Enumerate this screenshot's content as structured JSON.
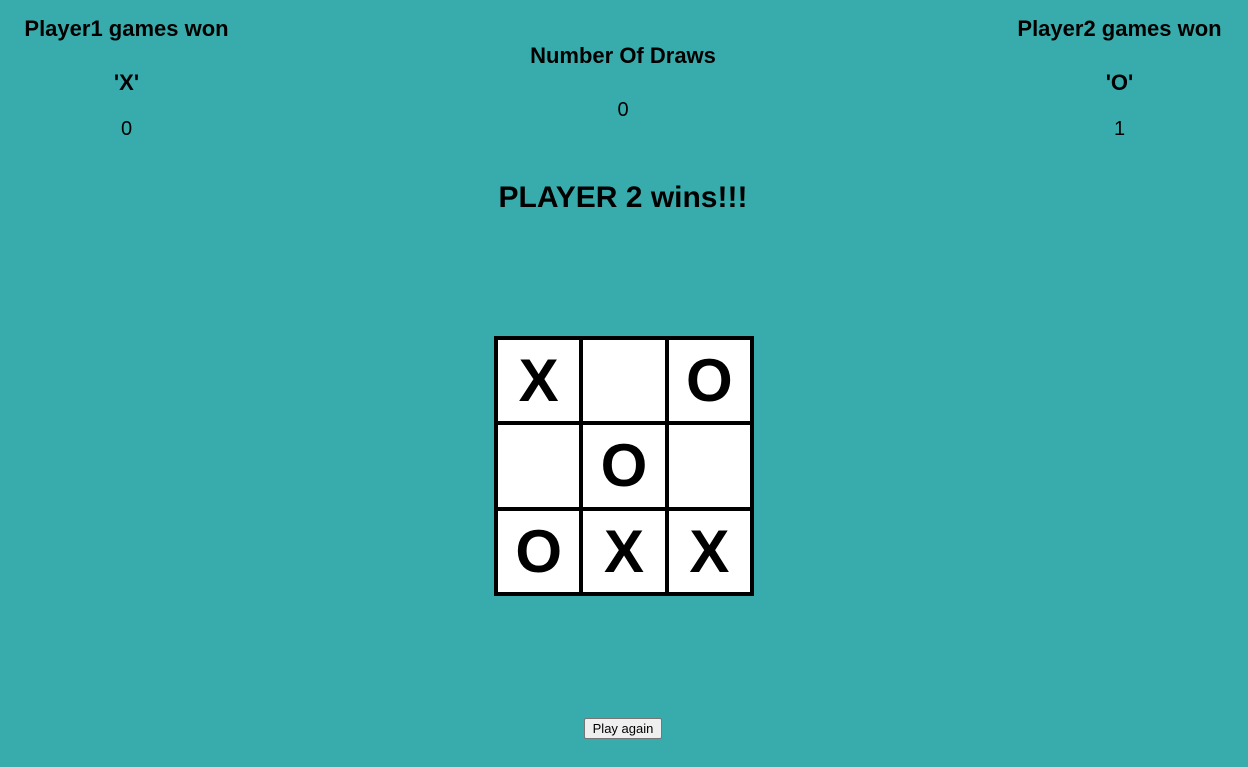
{
  "scoreboard": {
    "player1": {
      "title": "Player1 games won",
      "symbol": "'X'",
      "count": "0"
    },
    "draws": {
      "title": "Number Of Draws",
      "count": "0"
    },
    "player2": {
      "title": "Player2 games won",
      "symbol": "'O'",
      "count": "1"
    }
  },
  "result": "PLAYER 2 wins!!!",
  "board": {
    "cells": [
      "X",
      "",
      "O",
      "",
      "O",
      "",
      "O",
      "X",
      "X"
    ]
  },
  "play_again_label": "Play again",
  "colors": {
    "background": "#38acac",
    "board_border": "#000000",
    "cell": "#ffffff"
  }
}
